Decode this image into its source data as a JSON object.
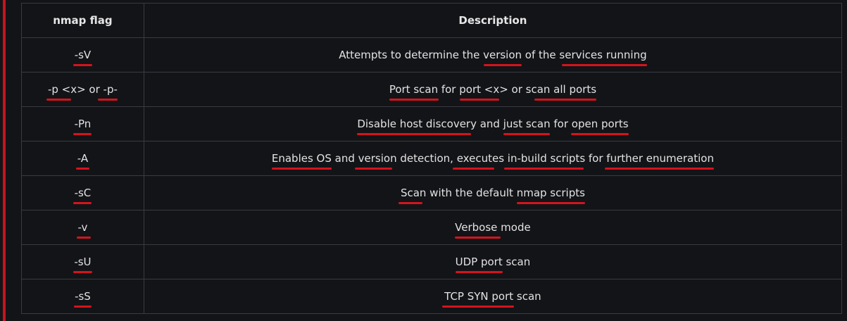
{
  "table": {
    "headers": {
      "flag": "nmap flag",
      "description": "Description"
    },
    "rows": [
      {
        "flag": "-sV",
        "description": "Attempts to determine the version of the services running"
      },
      {
        "flag": "-p <x> or -p-",
        "description": "Port scan for port <x> or scan all ports"
      },
      {
        "flag": "-Pn",
        "description": "Disable host discovery and just scan for open ports"
      },
      {
        "flag": "-A",
        "description": "Enables OS and version detection, executes in-build scripts for further enumeration"
      },
      {
        "flag": "-sC",
        "description": "Scan with the default nmap scripts"
      },
      {
        "flag": "-v",
        "description": "Verbose mode"
      },
      {
        "flag": "-sU",
        "description": "UDP port scan"
      },
      {
        "flag": "-sS",
        "description": "TCP SYN port scan"
      }
    ]
  },
  "colors": {
    "background": "#131418",
    "accent_bar": "#c8141c",
    "underline": "#d4141c",
    "grid": "#3a3b40",
    "text": "#e3e3e3"
  }
}
